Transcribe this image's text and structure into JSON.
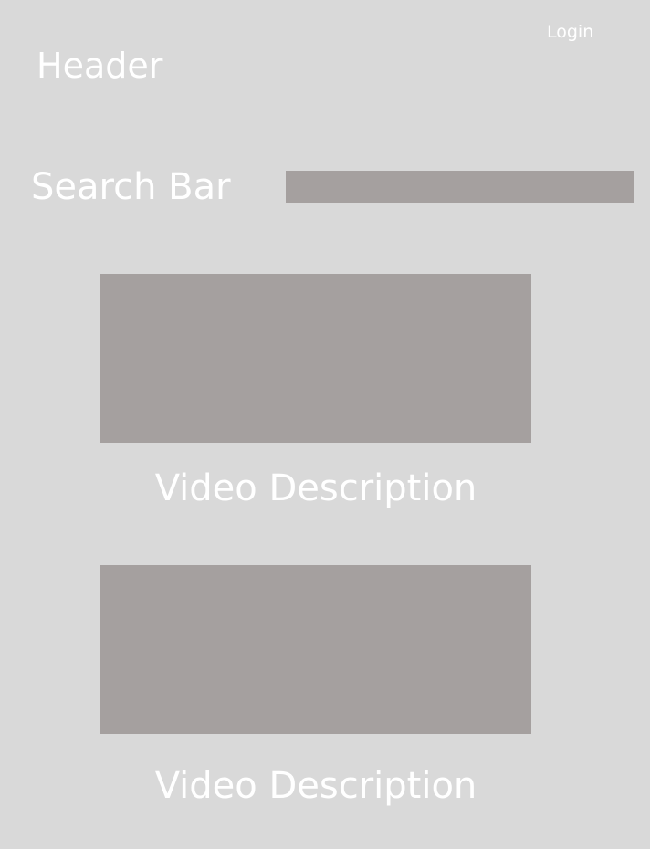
{
  "header": {
    "title": "Header",
    "login_label": "Login"
  },
  "search": {
    "label": "Search Bar",
    "value": "",
    "placeholder": ""
  },
  "videos": [
    {
      "description": "Video Description"
    },
    {
      "description": "Video Description"
    }
  ],
  "colors": {
    "background": "#d9d9d9",
    "placeholder_block": "#a5a09f",
    "text": "#ffffff"
  }
}
